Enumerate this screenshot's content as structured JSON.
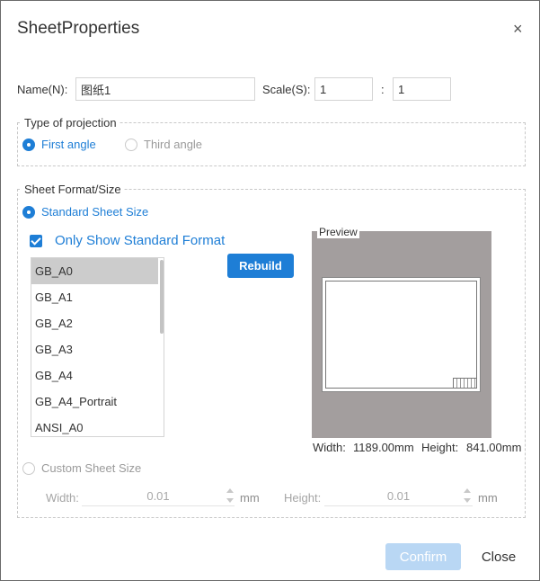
{
  "dialog": {
    "title": "SheetProperties",
    "close_glyph": "×"
  },
  "name_row": {
    "name_label": "Name(N):",
    "name_value": "图纸1",
    "scale_label": "Scale(S):",
    "scale_left": "1",
    "scale_sep": ":",
    "scale_right": "1"
  },
  "projection": {
    "legend": "Type of projection",
    "first_angle": "First angle",
    "third_angle": "Third angle",
    "selected": "First angle"
  },
  "sheet_format": {
    "legend": "Sheet Format/Size",
    "standard_label": "Standard Sheet Size",
    "only_standard_label": "Only Show Standard Format",
    "only_standard_checked": true,
    "rebuild_label": "Rebuild",
    "formats": [
      "GB_A0",
      "GB_A1",
      "GB_A2",
      "GB_A3",
      "GB_A4",
      "GB_A4_Portrait",
      "ANSI_A0"
    ],
    "selected_format": "GB_A0",
    "preview_label": "Preview",
    "width_label": "Width:",
    "width_value": "1189.00mm",
    "height_label": "Height:",
    "height_value": "841.00mm",
    "custom_label": "Custom Sheet Size",
    "custom_width_label": "Width:",
    "custom_width_value": "0.01",
    "custom_width_unit": "mm",
    "custom_height_label": "Height:",
    "custom_height_value": "0.01",
    "custom_height_unit": "mm"
  },
  "footer": {
    "confirm_label": "Confirm",
    "close_label": "Close"
  },
  "colors": {
    "accent": "#1e7ed6",
    "confirm_disabled": "#b9d7f4",
    "preview_bg": "#a39e9e"
  }
}
